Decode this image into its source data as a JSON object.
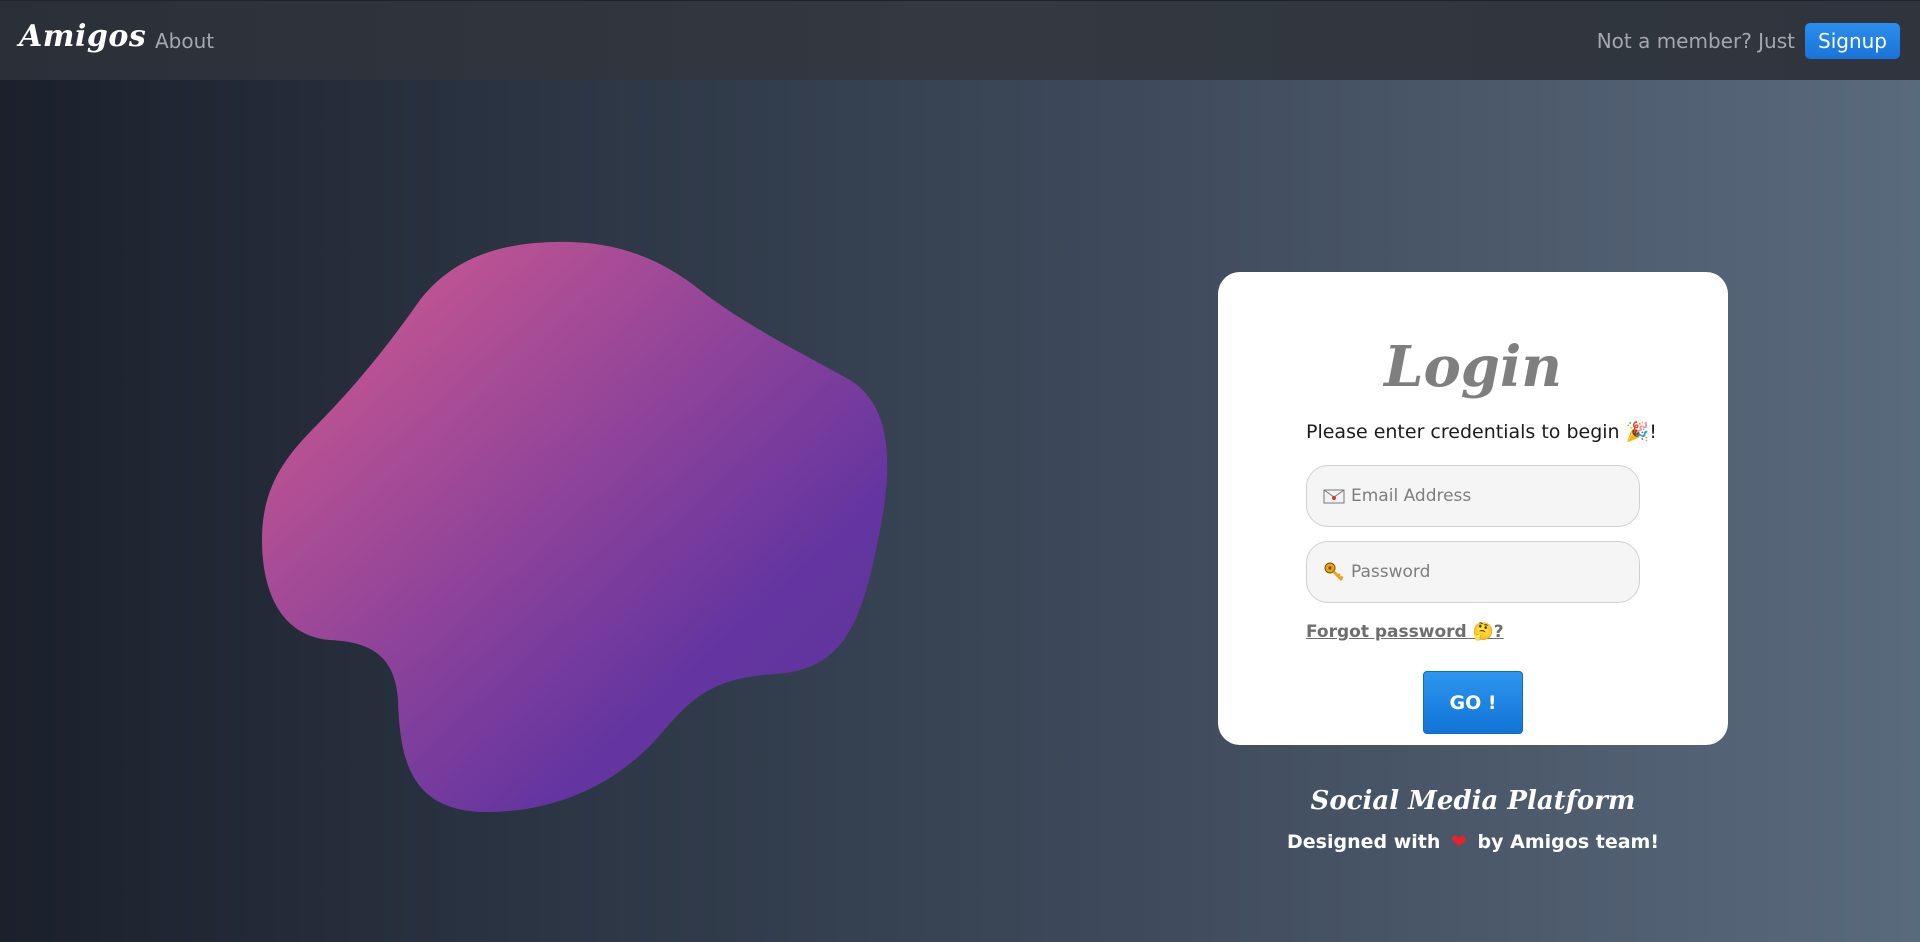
{
  "navbar": {
    "brand": "Amigos",
    "about_link": "About",
    "signup_prompt": "Not a member? Just",
    "signup_button": "Signup"
  },
  "hero": {
    "blob_colors": [
      "#d85c8e",
      "#6435a0"
    ]
  },
  "login": {
    "title": "Login",
    "subtitle": "Please enter credentials to begin 🎉!",
    "email": {
      "placeholder": "Email Address",
      "value": "",
      "icon": "envelope-icon"
    },
    "password": {
      "placeholder": "Password",
      "value": "",
      "icon": "key-icon"
    },
    "forgot_link": "Forgot password 🤔?",
    "submit_button": "GO !"
  },
  "footer": {
    "title": "Social Media Platform",
    "credit_before": "Designed with",
    "credit_heart": "❤",
    "credit_after": "by Amigos team!"
  },
  "colors": {
    "accent": "#1a73d9",
    "card_bg": "#ffffff",
    "title_gray": "#7f7f7f"
  }
}
